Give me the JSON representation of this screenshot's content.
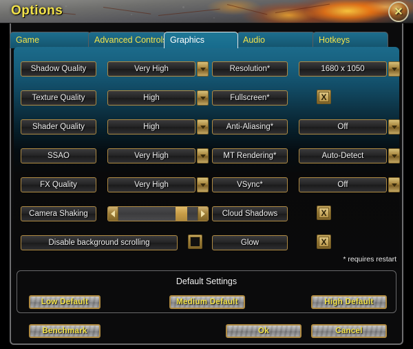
{
  "window": {
    "title": "Options",
    "close_icon": "close-x-icon"
  },
  "tabs": [
    {
      "label": "Game",
      "active": false
    },
    {
      "label": "Advanced Controls",
      "active": false
    },
    {
      "label": "Graphics",
      "active": true
    },
    {
      "label": "Audio",
      "active": false
    },
    {
      "label": "Hotkeys",
      "active": false
    }
  ],
  "settings": {
    "left_column": [
      {
        "label": "Shadow Quality",
        "type": "dropdown",
        "value": "Very High"
      },
      {
        "label": "Texture Quality",
        "type": "dropdown",
        "value": "High"
      },
      {
        "label": "Shader Quality",
        "type": "dropdown",
        "value": "High"
      },
      {
        "label": "SSAO",
        "type": "dropdown",
        "value": "Very High"
      },
      {
        "label": "FX Quality",
        "type": "dropdown",
        "value": "Very High"
      },
      {
        "label": "Camera Shaking",
        "type": "slider",
        "value": 87
      },
      {
        "label": "Disable background scrolling",
        "type": "checkbox",
        "checked": false
      }
    ],
    "right_column": [
      {
        "label": "Resolution*",
        "type": "dropdown",
        "value": "1680 x 1050"
      },
      {
        "label": "Fullscreen*",
        "type": "checkbox",
        "checked": true
      },
      {
        "label": "Anti-Aliasing*",
        "type": "dropdown",
        "value": "Off"
      },
      {
        "label": "MT Rendering*",
        "type": "dropdown",
        "value": "Auto-Detect"
      },
      {
        "label": "VSync*",
        "type": "dropdown",
        "value": "Off"
      },
      {
        "label": "Cloud Shadows",
        "type": "checkbox",
        "checked": true
      },
      {
        "label": "Glow",
        "type": "checkbox",
        "checked": true
      }
    ]
  },
  "restart_note": "* requires restart",
  "defaults": {
    "title": "Default Settings",
    "low": "Low Default",
    "medium": "Medium Default",
    "high": "High Default"
  },
  "actions": {
    "benchmark": "Benchmark",
    "ok": "Ok",
    "cancel": "Cancel"
  },
  "checkbox_mark": "X",
  "colors": {
    "accent_gold": "#b08b43",
    "title_yellow": "#f2e24a",
    "panel_teal": "#1c6b8b",
    "panel_dark": "#0a0a0b"
  }
}
